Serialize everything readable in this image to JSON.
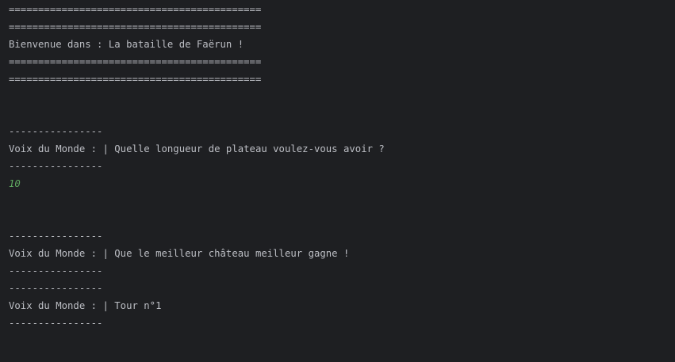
{
  "console": {
    "lines": [
      {
        "kind": "text",
        "text": "==========================================="
      },
      {
        "kind": "text",
        "text": "==========================================="
      },
      {
        "kind": "text",
        "text": "Bienvenue dans : La bataille de Faërun !"
      },
      {
        "kind": "text",
        "text": "==========================================="
      },
      {
        "kind": "text",
        "text": "==========================================="
      },
      {
        "kind": "blank",
        "text": ""
      },
      {
        "kind": "blank",
        "text": ""
      },
      {
        "kind": "text",
        "text": "----------------"
      },
      {
        "kind": "text",
        "text": "Voix du Monde : | Quelle longueur de plateau voulez-vous avoir ?"
      },
      {
        "kind": "text",
        "text": "----------------"
      },
      {
        "kind": "input",
        "text": "10"
      },
      {
        "kind": "blank",
        "text": ""
      },
      {
        "kind": "blank",
        "text": ""
      },
      {
        "kind": "text",
        "text": "----------------"
      },
      {
        "kind": "text",
        "text": "Voix du Monde : | Que le meilleur château meilleur gagne !"
      },
      {
        "kind": "text",
        "text": "----------------"
      },
      {
        "kind": "text",
        "text": "----------------"
      },
      {
        "kind": "text",
        "text": "Voix du Monde : | Tour n°1"
      },
      {
        "kind": "text",
        "text": "----------------"
      }
    ]
  },
  "colors": {
    "background": "#1e1f22",
    "text": "#bcbec4",
    "user_input": "#5fa860"
  }
}
